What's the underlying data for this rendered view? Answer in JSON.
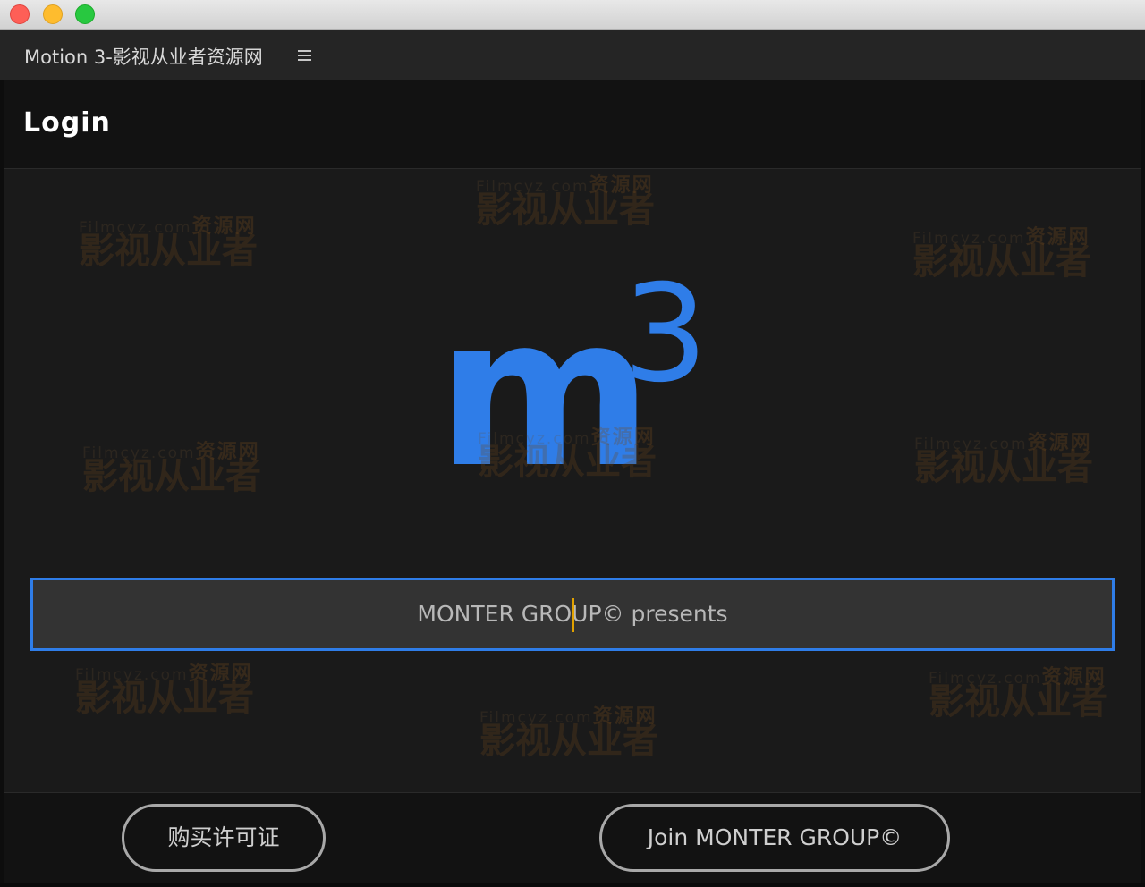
{
  "window": {
    "controls": {
      "close_color": "#fe5f57",
      "minimize_color": "#febc2e",
      "maximize_color": "#28c840"
    }
  },
  "panel": {
    "title": "Motion 3-影视从业者资源网",
    "menu_icon": "hamburger-menu-icon"
  },
  "login": {
    "heading": "Login"
  },
  "logo": {
    "letter": "m",
    "superscript": "3",
    "color": "#2f7de8"
  },
  "input": {
    "value": "MONTER GROUP© presents",
    "border_color": "#2f7de8"
  },
  "watermark": {
    "site": "Filmcyz.com",
    "tag": "资源网",
    "main": "影视从业者"
  },
  "footer": {
    "buy_button": "购买许可证",
    "join_button": "Join MONTER GROUP©"
  }
}
